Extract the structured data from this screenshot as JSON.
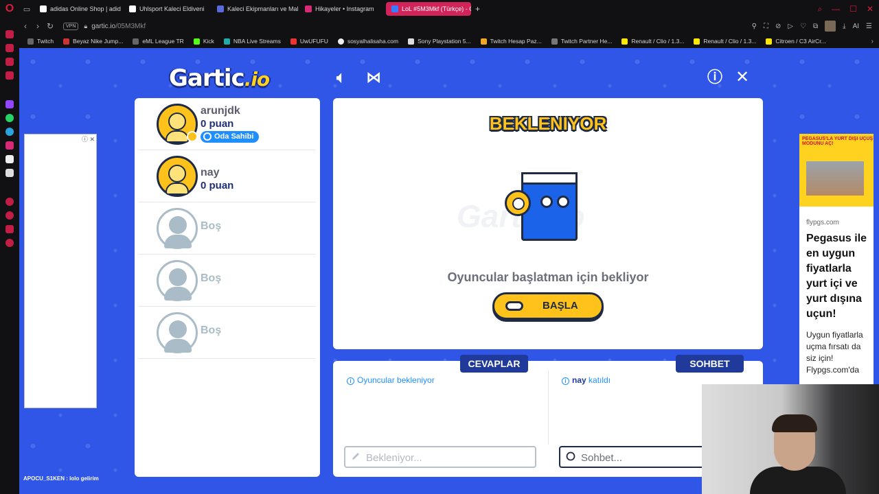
{
  "browser": {
    "tabs": [
      {
        "label": "adidas Online Shop | adid",
        "active": false
      },
      {
        "label": "Uhlsport Kaleci Eldiveni",
        "active": false
      },
      {
        "label": "Kaleci Ekipmanları ve Mal",
        "active": false
      },
      {
        "label": "Hikayeler • Instagram",
        "active": false
      },
      {
        "label": "LoL #5M3Mkf (Türkçe) - G",
        "active": true
      }
    ],
    "url_host": "gartic.io",
    "url_path": "/05M3Mkf",
    "vpn_label": "VPN",
    "ai_label": "AI",
    "bookmarks": [
      "Twitch",
      "Beyaz Nike Jump...",
      "eML League TR",
      "Kick",
      "NBA Live Streams",
      "UwUFUFU",
      "sosyalhalisaha.com",
      "Sony Playstation 5...",
      "Twitch Hesap Paz...",
      "Twitch Partner He...",
      "Renault / Clio / 1.3...",
      "Renault / Clio / 1.3...",
      "Citroen / C3 AirCr..."
    ]
  },
  "app": {
    "logo_main": "Gartic",
    "logo_suffix": ".io"
  },
  "players": [
    {
      "name": "arunjdk",
      "score": "0 puan",
      "owner_badge": "Oda Sahibi"
    },
    {
      "name": "nay",
      "score": "0 puan"
    }
  ],
  "empty_slots": [
    "Boş",
    "Boş",
    "Boş"
  ],
  "main": {
    "title": "BEKLENIYOR",
    "watermark": "Gartic.io",
    "subtitle": "Oyuncular başlatman için bekliyor",
    "start_button": "BAŞLA"
  },
  "answers": {
    "tab": "CEVAPLAR",
    "info": "Oyuncular bekleniyor",
    "placeholder": "Bekleniyor..."
  },
  "chat": {
    "tab": "SOHBET",
    "info_name": "nay",
    "info_text": "katıldı",
    "placeholder": "Sohbet..."
  },
  "ad_right": {
    "banner_text": "PEGASUS'LA YURT DIŞI UÇUŞ MODUNU AÇ!",
    "domain": "flypgs.com",
    "headline": "Pegasus ile en uygun fiyatlarla yurt içi ve yurt dışına uçun!",
    "desc": "Uygun fiyatlarla uçma fırsatı da siz için! Flypgs.com'da"
  },
  "stream_overlay": "APOCU_S1KEN : lolo gelirim",
  "colors": {
    "page_bg": "#2f56e6",
    "accent_yellow": "#ffc21a",
    "navy": "#1f3a9a",
    "link_blue": "#1f8fff"
  }
}
